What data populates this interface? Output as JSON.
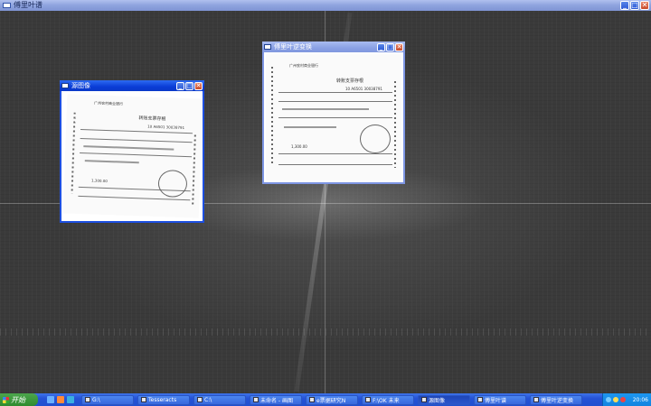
{
  "main_window": {
    "title": "傅里叶谱",
    "buttons": {
      "minimize": "_",
      "maximize": "□",
      "close": "✕"
    }
  },
  "windows": [
    {
      "id": "source",
      "title": "源图像",
      "active": true,
      "image": "receipt-scan"
    },
    {
      "id": "inverse",
      "title": "傅里叶逆变换",
      "active": false,
      "image": "receipt-scan"
    }
  ],
  "receipt": {
    "bank": "广州农村商业银行",
    "heading": "转账支票存根",
    "number": "10 A6501 30038791",
    "amount": "1,300.00"
  },
  "taskbar": {
    "start_label": "开始",
    "buttons": [
      {
        "label": "G:\\",
        "active": false
      },
      {
        "label": "Tesseracts",
        "active": false
      },
      {
        "label": "C:\\",
        "active": false
      },
      {
        "label": "未命名 - 画图",
        "active": false
      },
      {
        "label": "e票据研究N",
        "active": false
      },
      {
        "label": "F:\\OK 未来",
        "active": false
      },
      {
        "label": "源图像",
        "active": true
      },
      {
        "label": "傅里叶谱",
        "active": false
      },
      {
        "label": "傅里叶逆变换",
        "active": false
      }
    ],
    "clock": "20:06"
  },
  "colors": {
    "taskbar": "#2552d6",
    "start": "#2e8b2e",
    "active_title": "#0a3cd6",
    "inactive_title": "#8aa1e4"
  }
}
